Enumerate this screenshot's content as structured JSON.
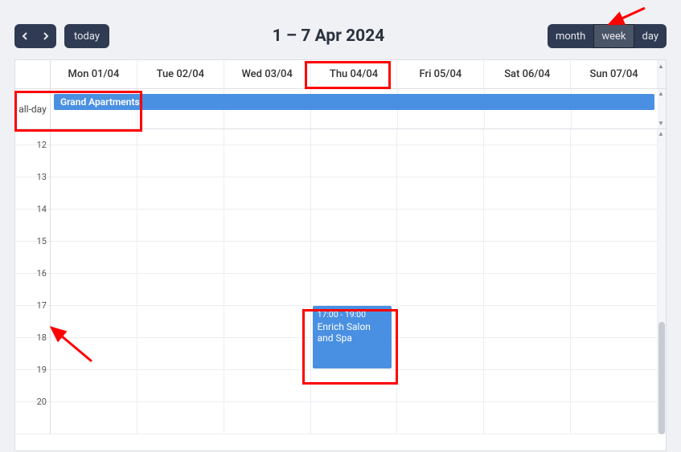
{
  "toolbar": {
    "today_label": "today",
    "title": "1 – 7 Apr 2024",
    "views": {
      "month": "month",
      "week": "week",
      "day": "day"
    }
  },
  "days": [
    {
      "label": "Mon 01/04"
    },
    {
      "label": "Tue 02/04"
    },
    {
      "label": "Wed 03/04"
    },
    {
      "label": "Thu 04/04"
    },
    {
      "label": "Fri 05/04"
    },
    {
      "label": "Sat 06/04"
    },
    {
      "label": "Sun 07/04"
    }
  ],
  "allday_label": "all-day",
  "allday_events": [
    {
      "title": "Grand Apartments"
    }
  ],
  "hours": [
    "",
    "12",
    "13",
    "14",
    "15",
    "16",
    "17",
    "18",
    "19",
    "20"
  ],
  "timed_event": {
    "time": "17:00 - 19:00",
    "title": "Enrich Salon and Spa"
  },
  "colors": {
    "event": "#4a90e2",
    "annotation": "#ff0000"
  }
}
